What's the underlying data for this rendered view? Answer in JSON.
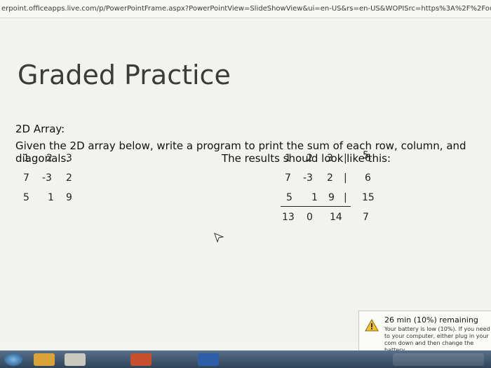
{
  "browser": {
    "url": "erpoint.officeapps.live.com/p/PowerPointFrame.aspx?PowerPointView=SlideShowView&ui=en-US&rs=en-US&WOPISrc=https%3A%2F%2Foutlook.office.com%2F"
  },
  "slide": {
    "title": "Graded Practice",
    "subtitle": "2D Array:",
    "instructions": "Given the 2D array below, write a program to print the sum of each row, column, and diagonals.",
    "results_label": "The results should look like this:",
    "input_grid": [
      [
        "1",
        "2",
        "3"
      ],
      [
        "7",
        "-3",
        "2"
      ],
      [
        "5",
        "1",
        "9"
      ]
    ],
    "result_grid": {
      "top_diag": "5",
      "rows": [
        {
          "cells": [
            "1",
            "2",
            "3"
          ],
          "sep": "|",
          "sum": "6"
        },
        {
          "cells": [
            "7",
            "-3",
            "2"
          ],
          "sep": "|",
          "sum": "6"
        },
        {
          "cells": [
            "5",
            "1",
            "9"
          ],
          "sep": "|",
          "sum": "15"
        }
      ],
      "bottom": [
        "13",
        "0",
        "14",
        "7"
      ]
    }
  },
  "notification": {
    "headline": "26 min (10%) remaining",
    "body": "Your battery is low (10%). If you need to your computer, either plug in your com down and then change the battery.",
    "icon": "battery-warning-icon"
  },
  "taskbar": {
    "items": [
      "start-icon",
      "explorer-icon",
      "chrome-icon",
      "powerpoint-icon",
      "word-icon"
    ],
    "accent": "#3a5068"
  }
}
